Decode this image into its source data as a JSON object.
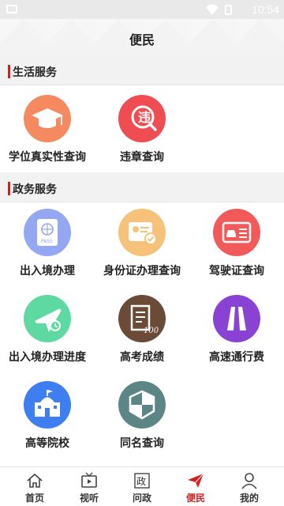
{
  "status_bar": {
    "time": "10:54"
  },
  "header": {
    "title": "便民"
  },
  "sections": {
    "life": {
      "title": "生活服务",
      "items": [
        {
          "label": "学位真实性查询",
          "icon": "graduation-cap-icon",
          "color": "#f58a61"
        },
        {
          "label": "违章查询",
          "icon": "violation-icon",
          "color": "#f04d52"
        }
      ]
    },
    "gov": {
      "title": "政务服务",
      "items": [
        {
          "label": "出入境办理",
          "icon": "passport-icon",
          "color": "#93a7f3"
        },
        {
          "label": "身份证办理查询",
          "icon": "id-card-icon",
          "color": "#f6c27a"
        },
        {
          "label": "驾驶证查询",
          "icon": "driver-license-icon",
          "color": "#f25a5a"
        },
        {
          "label": "出入境办理进度",
          "icon": "airplane-icon",
          "color": "#5fd9a2"
        },
        {
          "label": "高考成绩",
          "icon": "score-sheet-icon",
          "color": "#6b4a37"
        },
        {
          "label": "高速通行费",
          "icon": "highway-icon",
          "color": "#8a42d4"
        },
        {
          "label": "高等院校",
          "icon": "university-icon",
          "color": "#3f7ef0"
        },
        {
          "label": "同名查询",
          "icon": "shield-icon",
          "color": "#5c8686"
        }
      ]
    }
  },
  "tabbar": {
    "tabs": [
      {
        "label": "首页",
        "icon": "home-icon"
      },
      {
        "label": "视听",
        "icon": "tv-play-icon"
      },
      {
        "label": "问政",
        "icon": "zheng-icon"
      },
      {
        "label": "便民",
        "icon": "paper-plane-icon",
        "active": true
      },
      {
        "label": "我的",
        "icon": "user-icon"
      }
    ],
    "active_color": "#d42020"
  }
}
